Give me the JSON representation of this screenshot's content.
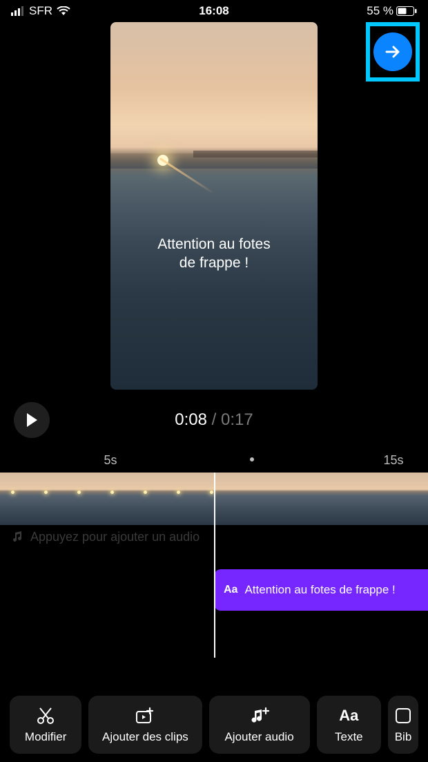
{
  "status_bar": {
    "carrier": "SFR",
    "time": "16:08",
    "battery_text": "55 %"
  },
  "preview": {
    "overlay_line1": "Attention au fotes",
    "overlay_line2": "de frappe !"
  },
  "playback": {
    "current": "0:08",
    "total": "0:17"
  },
  "ruler": {
    "label_left": "5s",
    "label_right": "15s"
  },
  "audio_track": {
    "placeholder": "Appuyez pour ajouter un audio"
  },
  "text_clip": {
    "label": "Attention au fotes  de frappe !"
  },
  "toolbar": {
    "modify": "Modifier",
    "add_clips": "Ajouter des clips",
    "add_audio": "Ajouter audio",
    "text": "Texte",
    "library": "Bib"
  }
}
